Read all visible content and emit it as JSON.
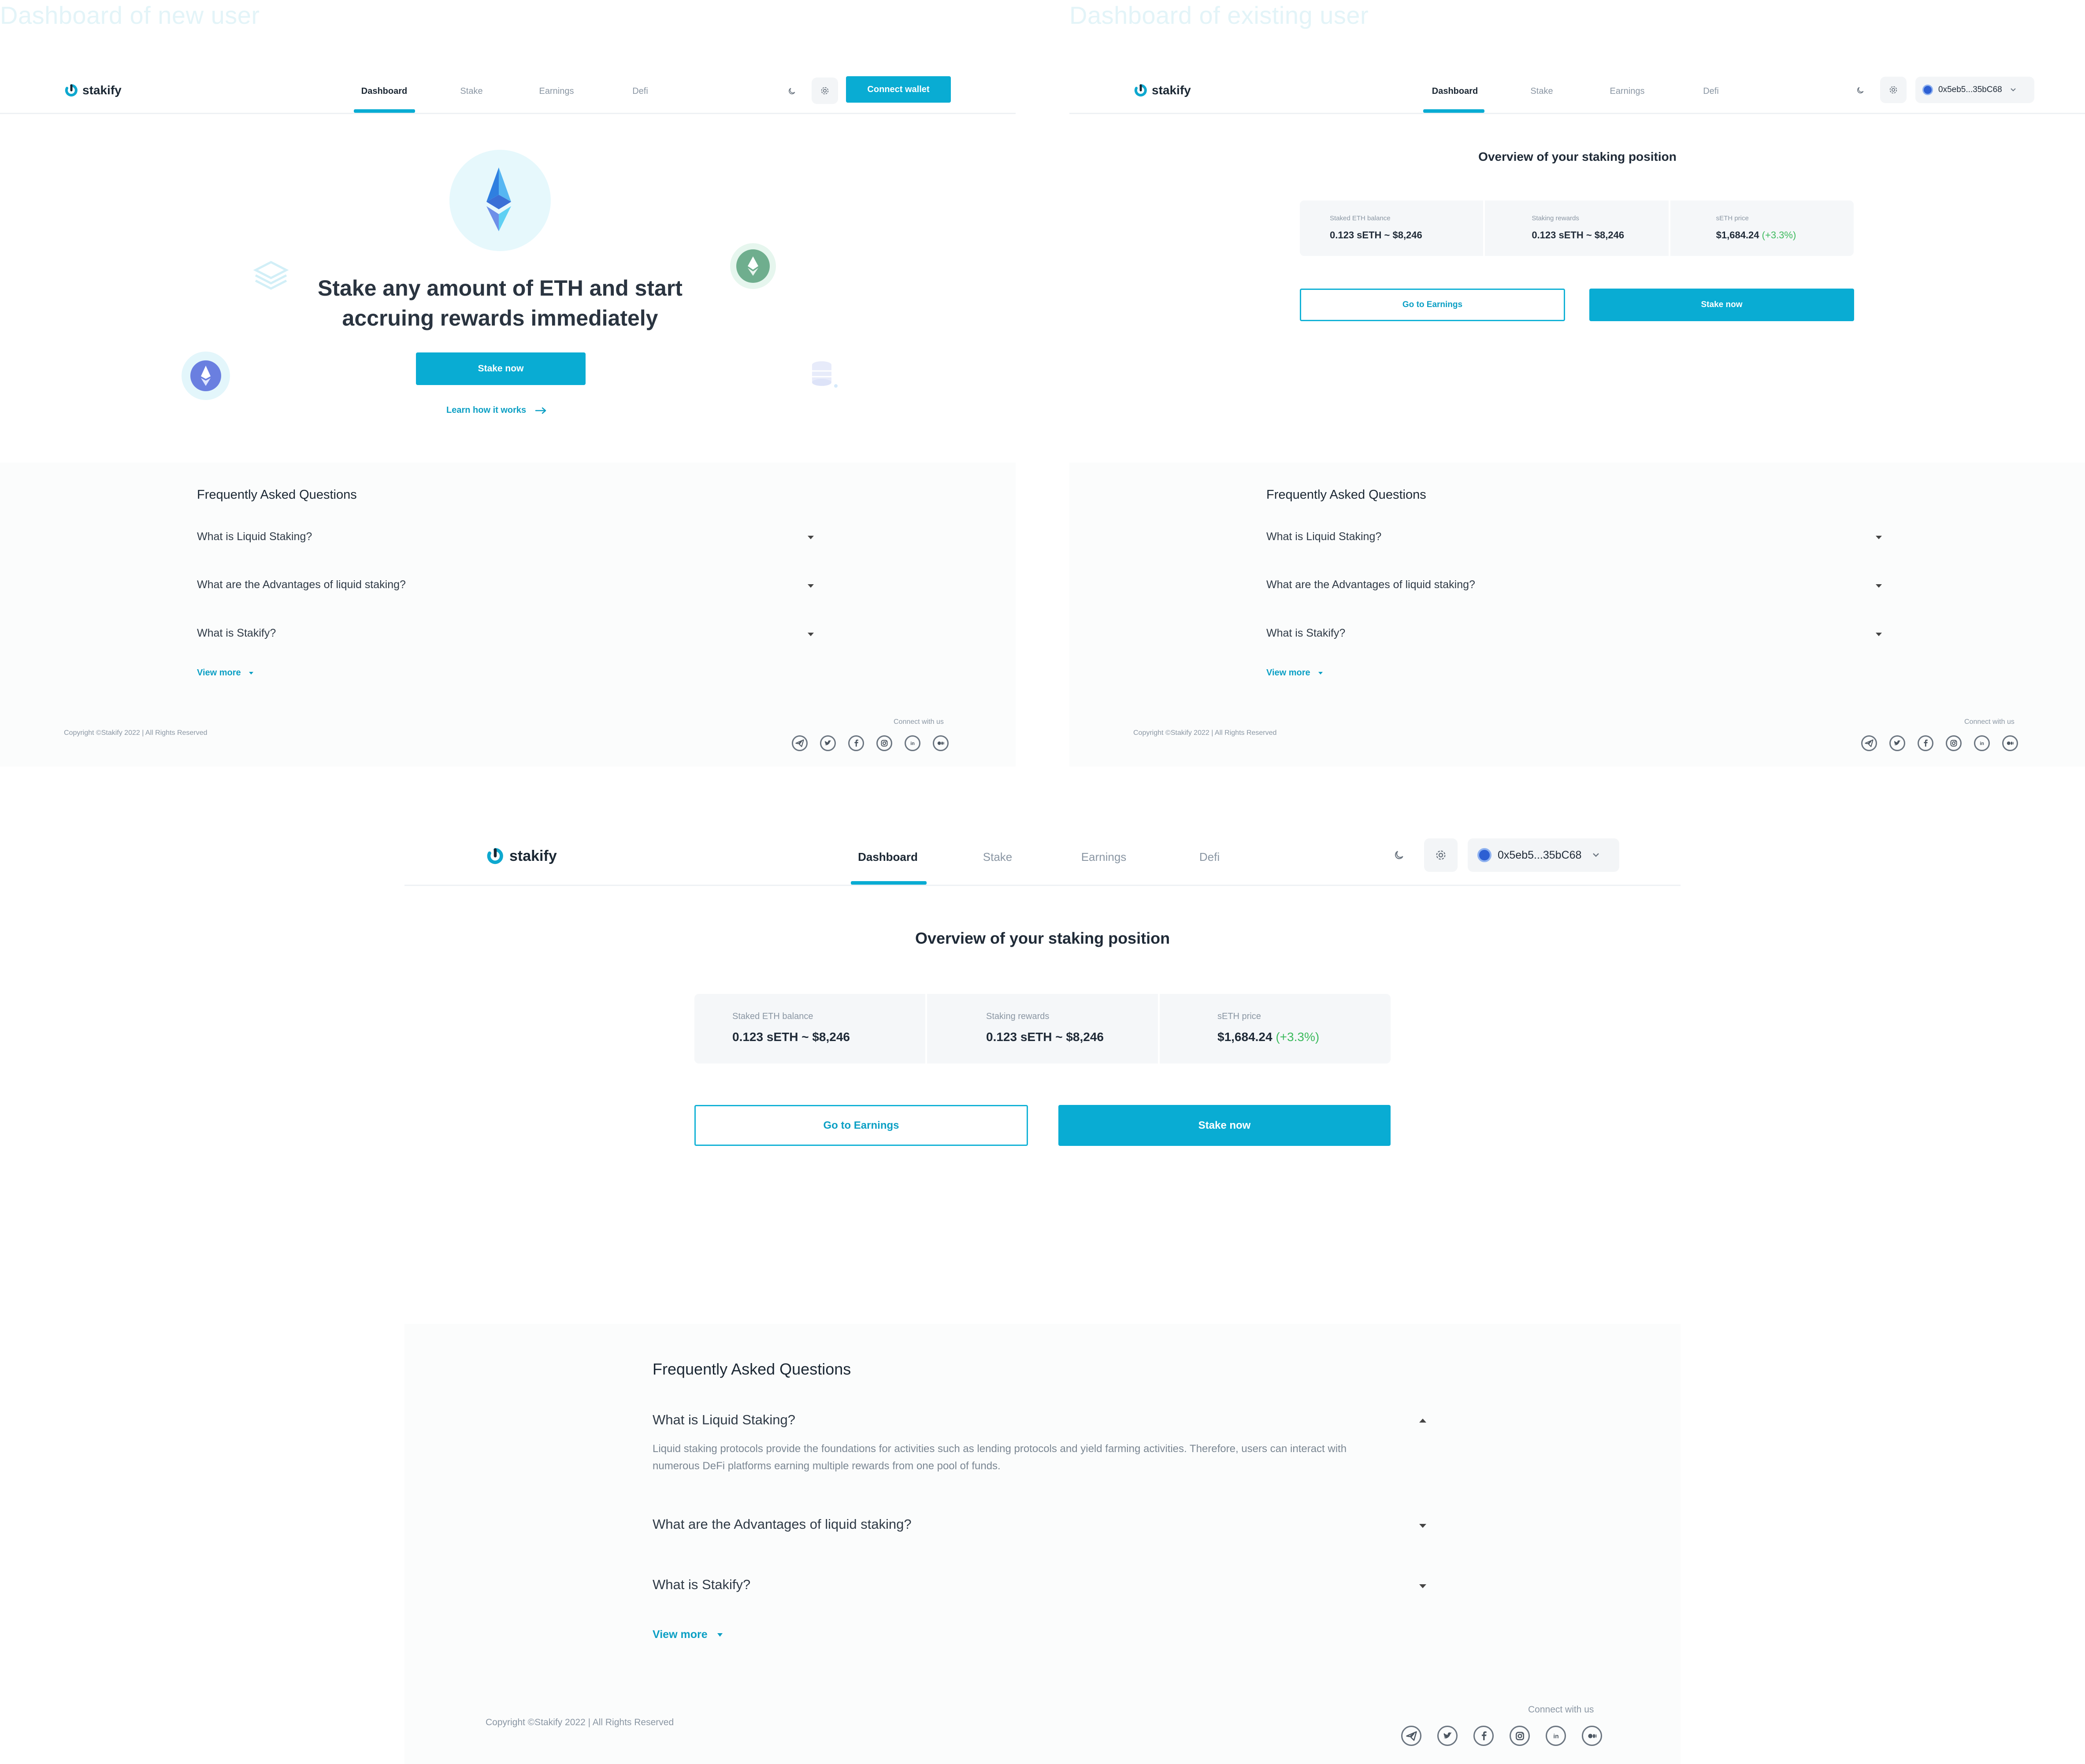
{
  "canvas": {
    "new_user_title": "Dashboard of new user",
    "existing_user_title": "Dashboard of existing user"
  },
  "brand": {
    "name": "stakify",
    "accent": "#09acd3",
    "positive": "#3cba5d"
  },
  "nav": {
    "tabs": [
      "Dashboard",
      "Stake",
      "Earnings",
      "Defi"
    ],
    "active_tab": "Dashboard",
    "theme_icon": "moon-icon",
    "settings_icon": "gear-icon",
    "connect_wallet": "Connect wallet",
    "wallet_address": "0x5eb5...35bC68"
  },
  "hero": {
    "title_line1": "Stake any amount of ETH and start",
    "title_line2": "accruing rewards immediately",
    "stake_button": "Stake now",
    "learn_link": "Learn how it works"
  },
  "overview": {
    "title": "Overview of your staking position",
    "stats": [
      {
        "label": "Staked ETH balance",
        "value": "0.123 sETH ~ $8,246",
        "change": ""
      },
      {
        "label": "Staking rewards",
        "value": "0.123 sETH ~ $8,246",
        "change": ""
      },
      {
        "label": "sETH price",
        "value": "$1,684.24",
        "change": "(+3.3%)"
      }
    ],
    "earnings_button": "Go to Earnings",
    "stake_button": "Stake now"
  },
  "faq": {
    "title": "Frequently Asked Questions",
    "questions": [
      "What is Liquid Staking?",
      "What are the Advantages of liquid staking?",
      "What is Stakify?"
    ],
    "answer_1": "Liquid staking protocols provide the foundations for activities such as lending protocols and yield farming activities. Therefore, users can interact with numerous DeFi platforms earning multiple rewards from one pool of funds.",
    "view_more": "View more"
  },
  "footer": {
    "copyright": "Copyright ©Stakify 2022 | All Rights Reserved",
    "connect_label": "Connect with us",
    "socials": [
      "telegram-icon",
      "twitter-icon",
      "facebook-icon",
      "instagram-icon",
      "linkedin-icon",
      "medium-icon"
    ]
  }
}
